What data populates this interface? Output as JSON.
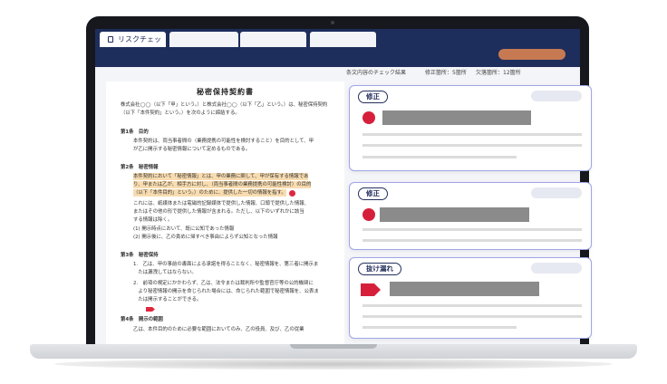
{
  "tabs": [
    {
      "label": "リスクチェック",
      "icon": "document-icon"
    }
  ],
  "status": {
    "summary": "条文内容のチェック結果",
    "fix_count": "修正箇所：5箇所",
    "missing_count": "欠落箇所：12箇所"
  },
  "document": {
    "title": "秘密保持契約書",
    "lines": [
      "株式会社◯◯（以下「甲」という。）と株式会社◯◯（以下「乙」という。）は、秘密保持契約",
      "（以下「本件契約」という。）を次のように締結する。",
      "第1条　目的",
      "本件契約は、両当事者間の（業務提携の可能性を検討すること）を目的として、甲",
      "が乙に開示する秘密情報について定めるものである。",
      "第2条　秘密情報",
      "本件契約において「秘密情報」とは、甲の業務に関して、甲が保有する情報であ",
      "り、甲または乙が、相手方に対し、（両当事者間の業務提携の可能性検討）の目的",
      "（以下「本件目的」という。）のために、提供した一切の情報を指す。",
      "これには、紙媒体または電磁的記録媒体で提供した情報、口頭で提供した情報、",
      "またはその他の形で提供した情報が含まれる。ただし、以下のいずれかに該当",
      "する情報は除く。",
      "(1) 開示時点において、既に公知であった情報",
      "(2) 開示後に、乙の責めに帰すべき事由によらず公知となった情報",
      "第3条　秘密保持",
      "1.　乙は、甲の事前の書面による承諾を得ることなく、秘密情報を、第三者に開示ま",
      "　たは漏洩してはならない。",
      "2.　前項の規定にかかわらず、乙は、法令または裁判所や監督官庁等の公的機関に",
      "　より秘密情報の開示を命じられた場合には、命じられた範囲で秘密情報を、公表ま",
      "　たは開示することができる。",
      "第4条　開示の範囲",
      "乙は、本件目的のために必要な範囲においてのみ、乙の役員、及び、乙の従業"
    ]
  },
  "cards": [
    {
      "badge": "修正",
      "marker": "circle"
    },
    {
      "badge": "修正",
      "marker": "circle"
    },
    {
      "badge": "抜け漏れ",
      "marker": "flag"
    }
  ],
  "colors": {
    "header": "#1d2d5c",
    "accent_button": "#c77a52",
    "marker_red": "#d6203b",
    "highlight": "#f8dcb0",
    "card_border": "#9ea6e8"
  }
}
